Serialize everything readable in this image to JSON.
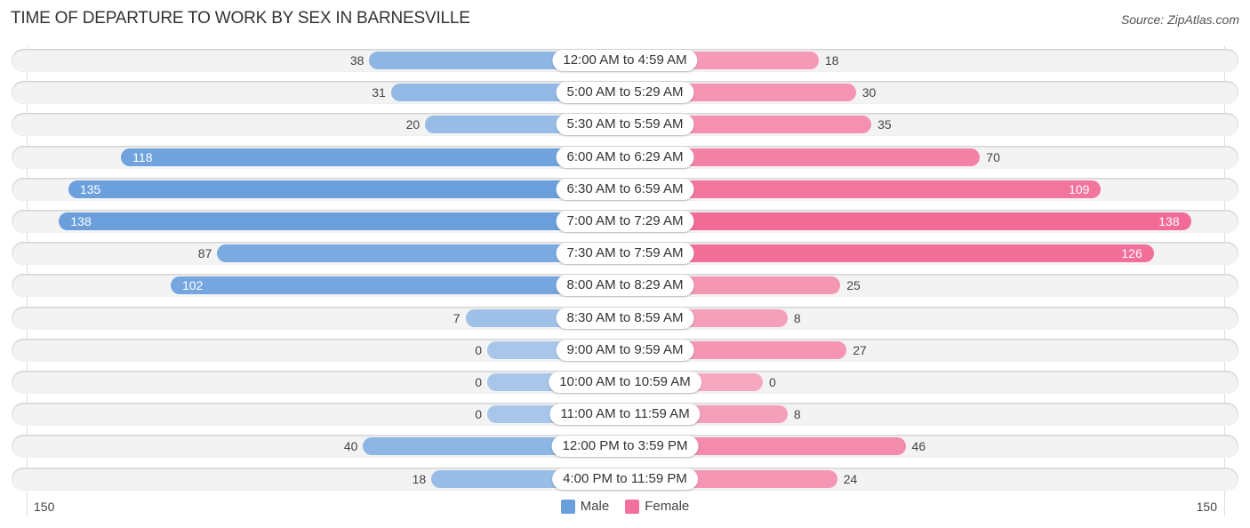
{
  "title": "TIME OF DEPARTURE TO WORK BY SEX IN BARNESVILLE",
  "source": "Source: ZipAtlas.com",
  "colors": {
    "male": "#6a9fdc",
    "male_light": "#a7c6ea",
    "female": "#f26b96",
    "female_light": "#f6a8c0"
  },
  "axis": {
    "left_label": "150",
    "right_label": "150"
  },
  "legend": [
    {
      "label": "Male",
      "color": "#6a9fdc"
    },
    {
      "label": "Female",
      "color": "#f2719b"
    }
  ],
  "chart_data": {
    "type": "bar",
    "orientation": "horizontal-diverging",
    "title": "TIME OF DEPARTURE TO WORK BY SEX IN BARNESVILLE",
    "xlim": [
      -150,
      150
    ],
    "legend_position": "bottom-center",
    "categories": [
      "12:00 AM to 4:59 AM",
      "5:00 AM to 5:29 AM",
      "5:30 AM to 5:59 AM",
      "6:00 AM to 6:29 AM",
      "6:30 AM to 6:59 AM",
      "7:00 AM to 7:29 AM",
      "7:30 AM to 7:59 AM",
      "8:00 AM to 8:29 AM",
      "8:30 AM to 8:59 AM",
      "9:00 AM to 9:59 AM",
      "10:00 AM to 10:59 AM",
      "11:00 AM to 11:59 AM",
      "12:00 PM to 3:59 PM",
      "4:00 PM to 11:59 PM"
    ],
    "series": [
      {
        "name": "Male",
        "values": [
          38,
          31,
          20,
          118,
          135,
          138,
          87,
          102,
          7,
          0,
          0,
          0,
          40,
          18
        ]
      },
      {
        "name": "Female",
        "values": [
          18,
          30,
          35,
          70,
          109,
          138,
          126,
          25,
          8,
          27,
          0,
          8,
          46,
          24
        ]
      }
    ]
  }
}
